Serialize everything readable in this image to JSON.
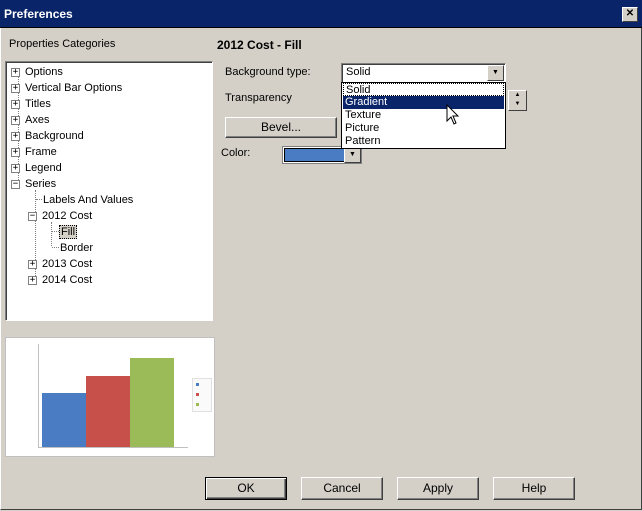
{
  "window": {
    "title": "Preferences",
    "close_glyph": "✕"
  },
  "categories": {
    "label": "Properties Categories",
    "tree": [
      {
        "label": "Options",
        "expander": "+"
      },
      {
        "label": "Vertical Bar Options",
        "expander": "+"
      },
      {
        "label": "Titles",
        "expander": "+"
      },
      {
        "label": "Axes",
        "expander": "+"
      },
      {
        "label": "Background",
        "expander": "+"
      },
      {
        "label": "Frame",
        "expander": "+"
      },
      {
        "label": "Legend",
        "expander": "+"
      },
      {
        "label": "Series",
        "expander": "−"
      },
      {
        "label": "Labels And Values"
      },
      {
        "label": "2012 Cost",
        "expander": "−"
      },
      {
        "label": "Fill",
        "selected": true
      },
      {
        "label": "Border"
      },
      {
        "label": "2013 Cost",
        "expander": "+"
      },
      {
        "label": "2014 Cost",
        "expander": "+"
      }
    ]
  },
  "panel": {
    "title": "2012 Cost - Fill",
    "background_type_label": "Background type:",
    "background_type_value": "Solid",
    "transparency_label": "Transparency",
    "bevel_button": "Bevel...",
    "color_label": "Color:",
    "color_value": "#4a7cc4"
  },
  "dropdown_options": [
    "Solid",
    "Gradient",
    "Texture",
    "Picture",
    "Pattern"
  ],
  "dropdown_highlighted": "Gradient",
  "buttons": {
    "ok": "OK",
    "cancel": "Cancel",
    "apply": "Apply",
    "help": "Help"
  },
  "chart_data": {
    "type": "bar",
    "categories": [
      "2012 Cost",
      "2013 Cost",
      "2014 Cost"
    ],
    "values": [
      7500000,
      10000000,
      12500000
    ],
    "colors": [
      "#4a7cc4",
      "#c8504b",
      "#9bbb59"
    ],
    "ylim": [
      0,
      14000000
    ]
  }
}
